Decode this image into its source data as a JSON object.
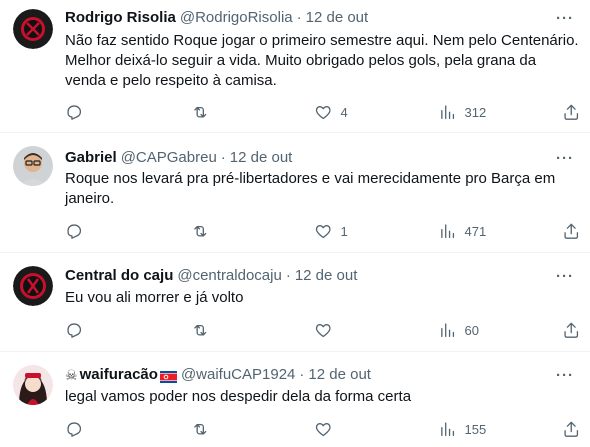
{
  "tweets": [
    {
      "name": "Rodrigo Risolia",
      "handle": "@RodrigoRisolia",
      "separator": "·",
      "date": "12 de out",
      "text": "Não faz sentido Roque jogar o primeiro semestre aqui. Nem pelo Centenário. Melhor deixá-lo seguir a vida. Muito obrigado pelos gols, pela grana da venda e pelo respeito à camisa.",
      "replies": "",
      "retweets": "",
      "likes": "4",
      "views": "312"
    },
    {
      "name": "Gabriel",
      "handle": "@CAPGabreu",
      "separator": "·",
      "date": "12 de out",
      "text": "Roque nos levará pra pré-libertadores e vai merecidamente pro Barça em janeiro.",
      "replies": "",
      "retweets": "",
      "likes": "1",
      "views": "471"
    },
    {
      "name": "Central do caju",
      "handle": "@centraldocaju",
      "separator": "·",
      "date": "12 de out",
      "text": "Eu vou ali morrer e já volto",
      "replies": "",
      "retweets": "",
      "likes": "",
      "views": "60"
    },
    {
      "name": "waifuracão",
      "handle": "@waifuCAP1924",
      "separator": "·",
      "date": "12 de out",
      "text": "legal vamos poder nos despedir dela da forma certa",
      "replies": "",
      "retweets": "",
      "likes": "",
      "views": "155"
    }
  ],
  "more_symbol": "···",
  "icons": {
    "reply": "reply-icon",
    "retweet": "retweet-icon",
    "like": "heart-icon",
    "views": "views-icon",
    "share": "share-icon",
    "more": "more-icon"
  },
  "colors": {
    "text": "#0f1419",
    "secondary": "#536471",
    "divider": "#eff3f4",
    "background": "#ffffff"
  }
}
